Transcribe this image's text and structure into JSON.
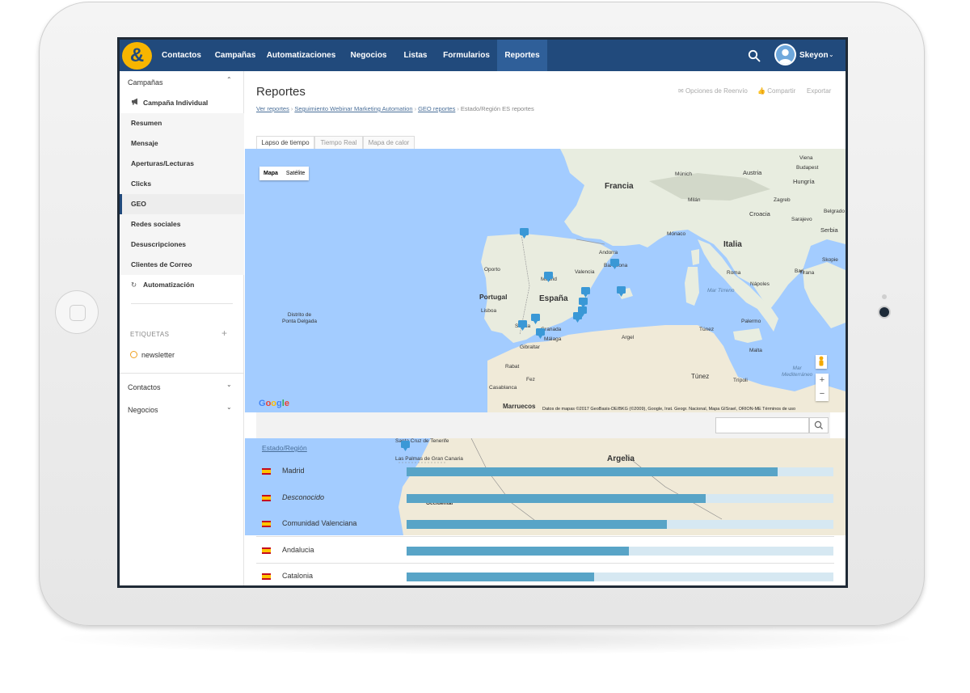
{
  "nav": {
    "logo": "&",
    "items": [
      "Contactos",
      "Campañas",
      "Automatizaciones",
      "Negocios",
      "Listas",
      "Formularios",
      "Reportes"
    ],
    "active": "Reportes",
    "user": "Skeyon"
  },
  "sidebar": {
    "section_campaigns": "Campañas",
    "items": [
      {
        "label": "Campaña Individual",
        "icon": "megaphone-icon"
      },
      {
        "label": "Resumen"
      },
      {
        "label": "Mensaje"
      },
      {
        "label": "Aperturas/Lecturas"
      },
      {
        "label": "Clicks"
      },
      {
        "label": "GEO"
      },
      {
        "label": "Redes sociales"
      },
      {
        "label": "Desuscripciones"
      },
      {
        "label": "Clientes de Correo"
      },
      {
        "label": "Automatización",
        "icon": "refresh-icon"
      }
    ],
    "active": "GEO",
    "tags_label": "ETIQUETAS",
    "tag": "newsletter",
    "section_contacts": "Contactos",
    "section_deals": "Negocios"
  },
  "page": {
    "title": "Reportes",
    "actions": {
      "resend": "Opciones de Reenvío",
      "share": "Compartir",
      "export": "Exportar"
    },
    "breadcrumb": {
      "links": [
        "Ver reportes",
        "Seguimiento Webinar Marketing Automation",
        "GEO reportes"
      ],
      "current": "Estado/Región ES reportes"
    },
    "tabs": [
      "Lapso de tiempo",
      "Tiempo Real",
      "Mapa de calor"
    ],
    "active_tab": "Lapso de tiempo"
  },
  "map": {
    "type_buttons": [
      "Mapa",
      "Satélite"
    ],
    "active_type": "Mapa",
    "labels": {
      "francia": "Francia",
      "espana": "España",
      "portugal": "Portugal",
      "italia": "Italia",
      "marruecos": "Marruecos",
      "argelia": "Argelia",
      "tunez": "Túnez",
      "mar_tirreno": "Mar Tirreno",
      "mar_mediterraneo": "Mar\nMediterráneo",
      "distrito": "Distrito de\nPonta Delgada",
      "madrid": "Madrid",
      "valencia": "Valencia",
      "barcelona": "Barcelona",
      "andorra": "Andorra",
      "malaga": "Málaga",
      "granada": "Granada",
      "sevilla": "Sevilla",
      "gibraltar": "Gibraltar",
      "porto": "Oporto",
      "lisboa": "Lisboa",
      "rabat": "Rabat",
      "casablanca": "Casablanca",
      "fez": "Fez",
      "argel": "Argel",
      "tunez_city": "Túnez",
      "tripoli": "Trípoli",
      "malta": "Malta",
      "monaco": "Mónaco",
      "roma": "Roma",
      "napoles": "Nápoles",
      "palermo": "Palermo",
      "bari": "Bari",
      "viena": "Viena",
      "budapest": "Budapest",
      "hungria": "Hungría",
      "austria": "Austria",
      "croacia": "Croacia",
      "serbia": "Serbia",
      "munich": "Múnich",
      "milan": "Milán",
      "zagreb": "Zagreb",
      "belgrado": "Belgrado",
      "sarajevo": "Sarajevo",
      "tirana": "Tirana",
      "skopje": "Skopie"
    },
    "credit": "Datos de mapas ©2017 GeoBasis-DE/BKG (©2009), Google, Inst. Geogr. Nacional, Mapa GISrael, ORION-ME   Términos de uso",
    "google": "Google",
    "zoom_in": "+",
    "zoom_out": "−"
  },
  "search": {
    "placeholder": ""
  },
  "lower_map": {
    "argelia": "Argelia",
    "las_palmas": "Las Palmas de Gran Canaria",
    "santa_cruz": "Santa Cruz de Tenerife",
    "occidental": "Occidental"
  },
  "table": {
    "header": "Estado/Región",
    "rows": [
      {
        "name": "Madrid",
        "italic": false,
        "fraction": 0.87
      },
      {
        "name": "Desconocido",
        "italic": true,
        "fraction": 0.7
      },
      {
        "name": "Comunidad Valenciana",
        "italic": false,
        "fraction": 0.61
      },
      {
        "name": "Andalucia",
        "italic": false,
        "fraction": 0.52
      },
      {
        "name": "Catalonia",
        "italic": false,
        "fraction": 0.44
      }
    ]
  },
  "colors": {
    "nav_bg": "#214a7c",
    "nav_active": "#2f5f99",
    "logo": "#f7b500",
    "bar": "#58a4c7",
    "bar_bg": "#d6e8f2",
    "sea": "#a3ccff",
    "land": "#f0ead8",
    "pin": "#3a98d6"
  }
}
